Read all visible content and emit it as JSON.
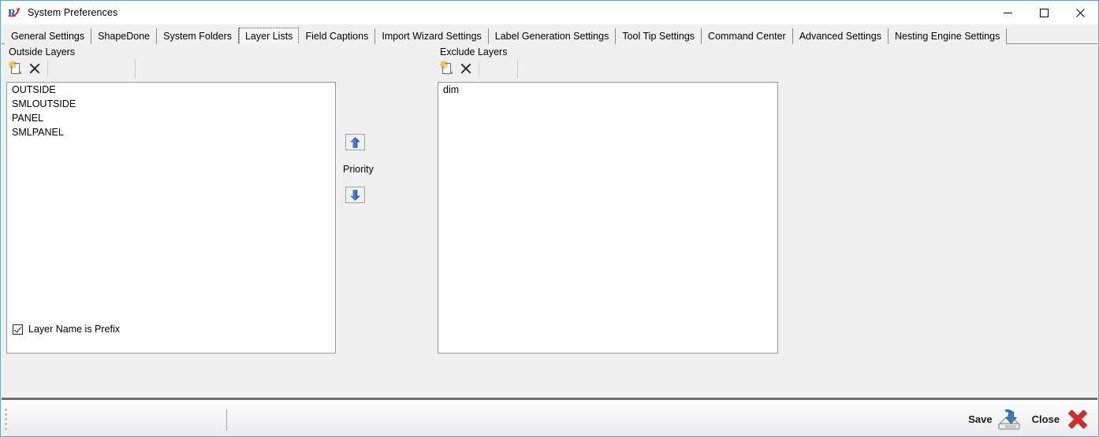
{
  "window": {
    "title": "System Preferences",
    "app_icon": "app-r-icon",
    "controls": {
      "minimize": "─",
      "maximize": "□",
      "close": "✕"
    }
  },
  "tabs": [
    {
      "label": "General Settings",
      "selected": false
    },
    {
      "label": "ShapeDone",
      "selected": false
    },
    {
      "label": "System Folders",
      "selected": false
    },
    {
      "label": "Layer Lists",
      "selected": true
    },
    {
      "label": "Field Captions",
      "selected": false
    },
    {
      "label": "Import Wizard Settings",
      "selected": false
    },
    {
      "label": "Label Generation Settings",
      "selected": false
    },
    {
      "label": "Tool Tip Settings",
      "selected": false
    },
    {
      "label": "Command Center",
      "selected": false
    },
    {
      "label": "Advanced Settings",
      "selected": false
    },
    {
      "label": "Nesting Engine Settings",
      "selected": false
    }
  ],
  "outside_layers": {
    "label": "Outside Layers",
    "toolbar": {
      "add_icon": "new-document-icon",
      "delete_icon": "delete-x-icon"
    },
    "items": [
      "OUTSIDE",
      "SMLOUTSIDE",
      "PANEL",
      "SMLPANEL"
    ]
  },
  "exclude_layers": {
    "label": "Exclude Layers",
    "toolbar": {
      "add_icon": "new-document-icon",
      "delete_icon": "delete-x-icon"
    },
    "items": [
      "dim"
    ]
  },
  "priority": {
    "label": "Priority",
    "up_icon": "arrow-up-icon",
    "down_icon": "arrow-down-icon"
  },
  "options": {
    "layer_name_is_prefix": {
      "label": "Layer Name is Prefix",
      "checked": true
    }
  },
  "bottom_bar": {
    "save_label": "Save",
    "save_icon": "save-drive-icon",
    "close_label": "Close",
    "close_icon": "close-red-x-icon"
  },
  "colors": {
    "window_border": "#4fa6dd",
    "page_background": "#f0f0f0",
    "listbox_background": "#ffffff",
    "accent_arrow_blue": "#2f6fd0",
    "close_red": "#d42a2a",
    "icon_yellow": "#f2b01e"
  }
}
